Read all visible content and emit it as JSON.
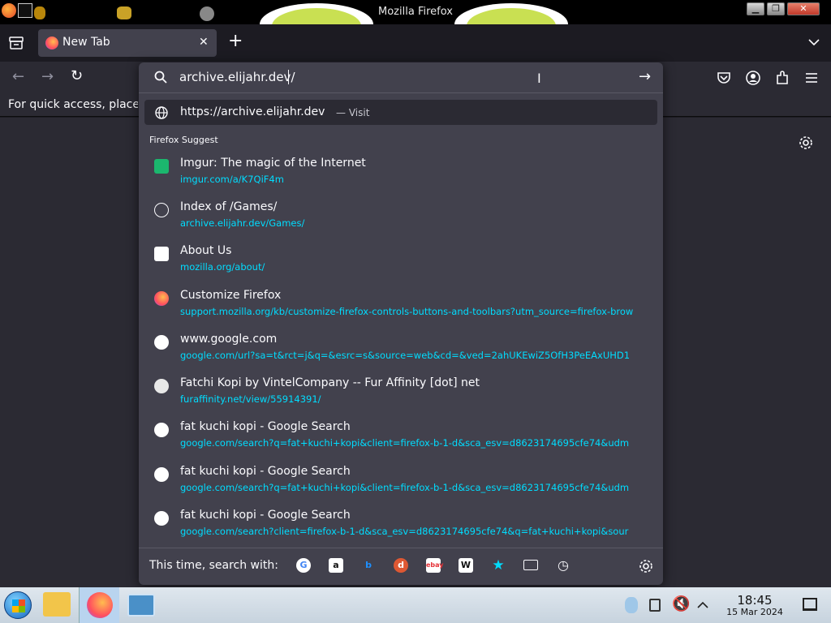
{
  "window": {
    "title": "Mozilla Firefox"
  },
  "tab": {
    "title": "New Tab"
  },
  "bookmarks_toolbar": {
    "text": "For quick access, place y"
  },
  "urlbar": {
    "value": "archive.elijahr.dev/"
  },
  "visit_row": {
    "url": "https://archive.elijahr.dev",
    "separator": "—",
    "action": "Visit"
  },
  "suggest_header": "Firefox Suggest",
  "results": [
    {
      "icon": "imgur-icon",
      "title": "Imgur: The magic of the Internet",
      "url": "imgur.com/a/K7QiF4m"
    },
    {
      "icon": "globe-icon",
      "title": "Index of /Games/",
      "url": "archive.elijahr.dev/Games/"
    },
    {
      "icon": "medium-icon",
      "title": "About Us",
      "url": "mozilla.org/about/"
    },
    {
      "icon": "firefox-icon",
      "title": "Customize Firefox",
      "url": "support.mozilla.org/kb/customize-firefox-controls-buttons-and-toolbars?utm_source=firefox-brow"
    },
    {
      "icon": "google-icon",
      "title": "www.google.com",
      "url": "google.com/url?sa=t&rct=j&q=&esrc=s&source=web&cd=&ved=2ahUKEwiZ5OfH3PeEAxUHD1"
    },
    {
      "icon": "furaffinity-icon",
      "title": "Fatchi Kopi by VintelCompany -- Fur Affinity [dot] net",
      "url": "furaffinity.net/view/55914391/"
    },
    {
      "icon": "google-icon",
      "title": "fat kuchi kopi - Google Search",
      "url": "google.com/search?q=fat+kuchi+kopi&client=firefox-b-1-d&sca_esv=d8623174695cfe74&udm"
    },
    {
      "icon": "google-icon",
      "title": "fat kuchi kopi - Google Search",
      "url": "google.com/search?q=fat+kuchi+kopi&client=firefox-b-1-d&sca_esv=d8623174695cfe74&udm"
    },
    {
      "icon": "google-icon",
      "title": "fat kuchi kopi - Google Search",
      "url": "google.com/search?client=firefox-b-1-d&sca_esv=d8623174695cfe74&q=fat+kuchi+kopi&sour"
    }
  ],
  "footer": {
    "label": "This time, search with:"
  },
  "taskbar": {
    "time": "18:45",
    "date": "15 Mar 2024"
  },
  "colors": {
    "accent": "#00ddff",
    "panel": "#42414d",
    "toolbar": "#2b2a33"
  }
}
